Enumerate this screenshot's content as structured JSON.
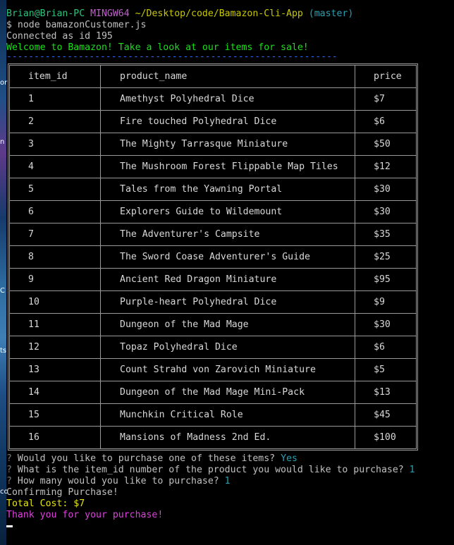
{
  "prompt": {
    "user": "Brian@Brian-PC",
    "host": "MINGW64",
    "path": "~/Desktop/code/Bamazon-Cli-App",
    "branch": "(master)"
  },
  "command": "$ node bamazonCustomer.js",
  "connected": "Connected as id 195",
  "welcome": "Welcome to Bamazon! Take a look at our items for sale!",
  "divider": "------------------------------------------------------------",
  "table": {
    "headers": [
      "item_id",
      "product_name",
      "price"
    ],
    "rows": [
      [
        "1",
        "Amethyst Polyhedral Dice",
        "$7"
      ],
      [
        "2",
        "Fire touched Polyhedral Dice",
        "$6"
      ],
      [
        "3",
        "The Mighty Tarrasque Miniature",
        "$50"
      ],
      [
        "4",
        "The Mushroom Forest Flippable Map Tiles",
        "$12"
      ],
      [
        "5",
        "Tales from the Yawning Portal",
        "$30"
      ],
      [
        "6",
        "Explorers Guide to Wildemount",
        "$30"
      ],
      [
        "7",
        "The Adventurer's Campsite",
        "$35"
      ],
      [
        "8",
        "The Sword Coase Adventurer's Guide",
        "$25"
      ],
      [
        "9",
        "Ancient Red Dragon Miniature",
        "$95"
      ],
      [
        "10",
        "Purple-heart Polyhedral Dice",
        "$9"
      ],
      [
        "11",
        "Dungeon of the Mad Mage",
        "$30"
      ],
      [
        "12",
        "Topaz Polyhedral Dice",
        "$6"
      ],
      [
        "13",
        "Count Strahd von Zarovich Miniature",
        "$5"
      ],
      [
        "14",
        "Dungeon of the Mad Mage Mini-Pack",
        "$13"
      ],
      [
        "15",
        "Munchkin Critical Role",
        "$45"
      ],
      [
        "16",
        "Mansions of Madness 2nd Ed.",
        "$100"
      ]
    ]
  },
  "questions": [
    {
      "mark": "?",
      "text": " Would you like to purchase one of these items? ",
      "answer": "Yes"
    },
    {
      "mark": "?",
      "text": " What is the item_id number of the product you would like to purchase? ",
      "answer": "1"
    },
    {
      "mark": "?",
      "text": " How many would you like to purchase? ",
      "answer": "1"
    }
  ],
  "confirming": "Confirming Purchase!",
  "total": "Total Cost: $7",
  "thanks": "Thank you for your purchase!",
  "colors": {
    "background": "#000000",
    "user": "#2ec27e",
    "host": "#c061cb",
    "path": "#c8c800",
    "welcome": "#19e019",
    "total": "#e5e510",
    "thanks": "#e040e0",
    "answer": "#2aa1b3"
  }
}
